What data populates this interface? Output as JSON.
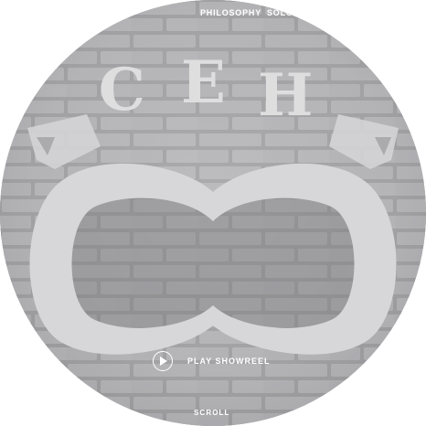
{
  "nav": {
    "items": [
      {
        "label": "PHILOSOPHY"
      },
      {
        "label": "SOLOV"
      }
    ]
  },
  "hero": {
    "sign_letters": [
      "C",
      "E",
      "H"
    ],
    "showreel_label": "PLAY SHOWREEL",
    "play_icon": "play-icon",
    "scroll_label": "SCROLL"
  },
  "colors": {
    "wall": "#a9a9ab",
    "brick_highlight": "#d8d8da",
    "logo": "#d2d2d4",
    "text": "#ffffff"
  }
}
